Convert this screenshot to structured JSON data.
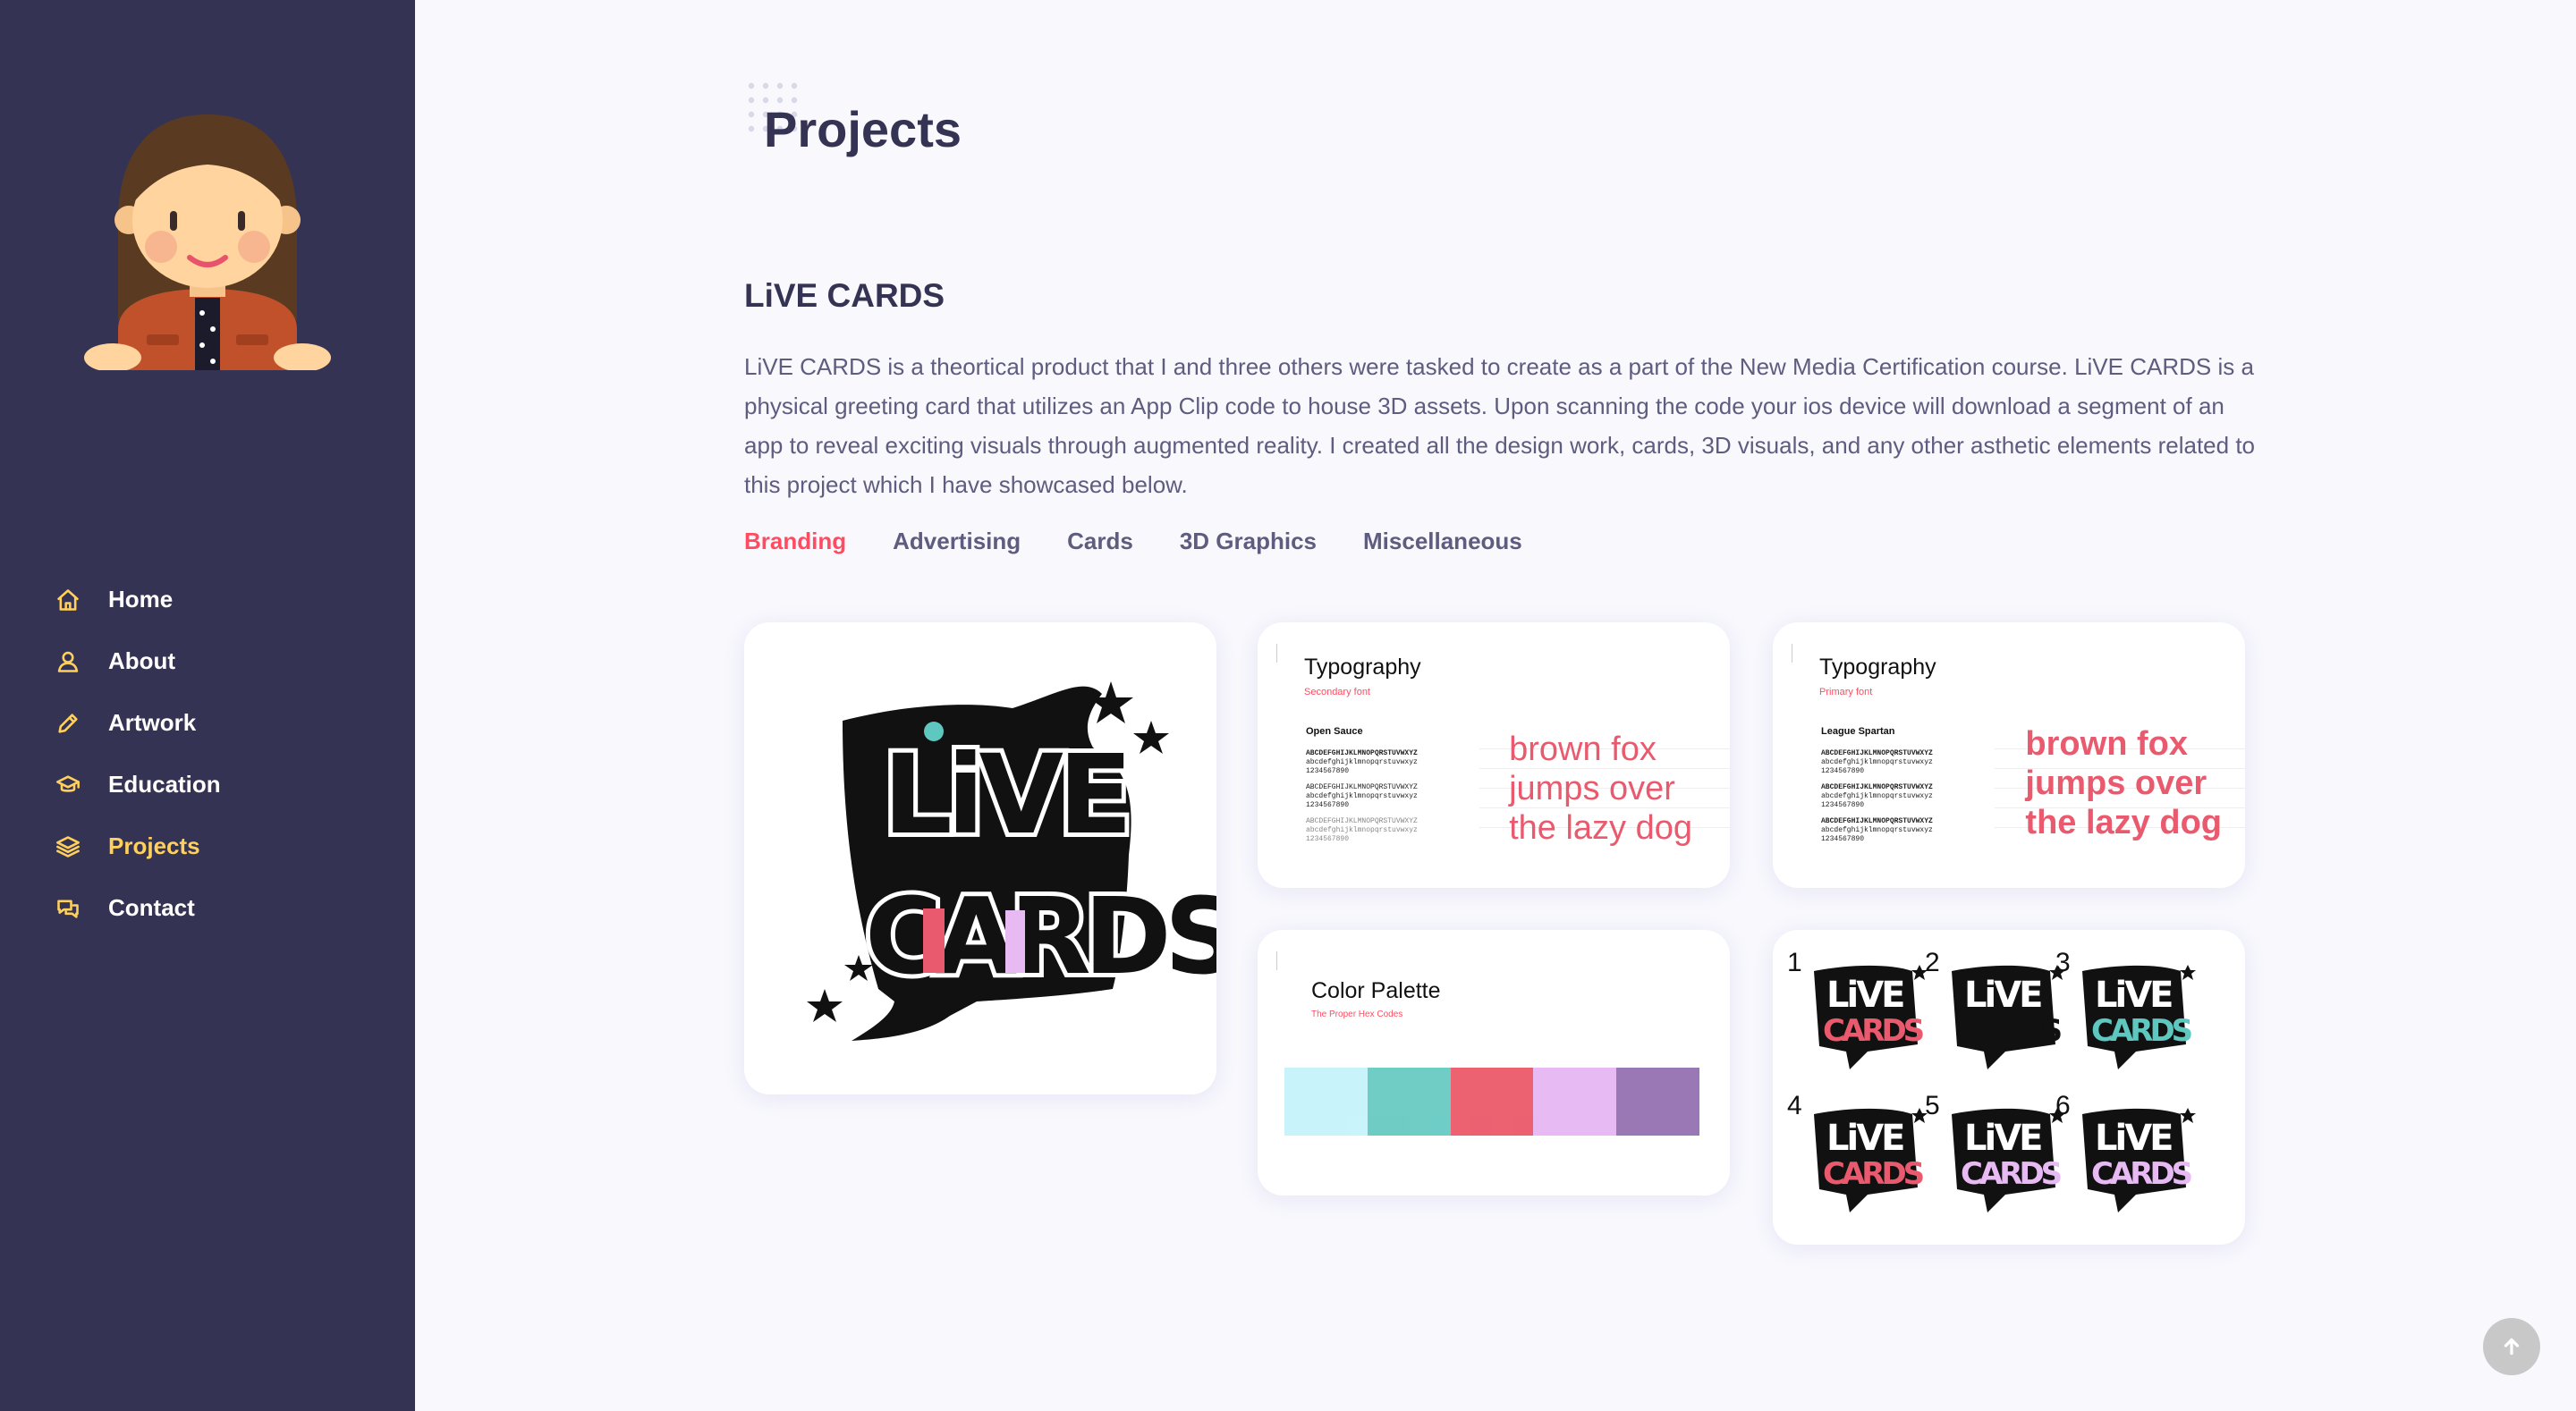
{
  "sidebar": {
    "nav": [
      {
        "label": "Home",
        "icon": "home-icon"
      },
      {
        "label": "About",
        "icon": "user-icon"
      },
      {
        "label": "Artwork",
        "icon": "pencil-icon"
      },
      {
        "label": "Education",
        "icon": "graduation-cap-icon"
      },
      {
        "label": "Projects",
        "icon": "layers-icon",
        "active": true
      },
      {
        "label": "Contact",
        "icon": "chat-bubbles-icon"
      }
    ]
  },
  "main": {
    "page_title": "Projects",
    "project": {
      "title": "LiVE CARDS",
      "description": "LiVE CARDS is a theortical product that I and three others were tasked to create as a part of the New Media Certification course. LiVE CARDS is a physical greeting card that utilizes an App Clip code to house 3D assets. Upon scanning the code your ios device will download a segment of an app to reveal exciting visuals through augmented reality. I created all the design work, cards, 3D visuals, and any other asthetic elements related to this project which I have showcased below."
    },
    "filters": [
      {
        "label": "Branding",
        "active": true
      },
      {
        "label": "Advertising"
      },
      {
        "label": "Cards"
      },
      {
        "label": "3D Graphics"
      },
      {
        "label": "Miscellaneous"
      }
    ],
    "gallery": {
      "typography_secondary": {
        "heading": "Typography",
        "subheading": "Secondary font",
        "font_name": "Open Sauce",
        "glyph_upper": "ABCDEFGHIJKLMNOPQRSTUVWXYZ",
        "glyph_lower": "abcdefghijklmnopqrstuvwxyz",
        "glyph_digits": "1234567890",
        "sample_line1": "brown fox",
        "sample_line2": "jumps over",
        "sample_line3": "the lazy dog"
      },
      "typography_primary": {
        "heading": "Typography",
        "subheading": "Primary font",
        "font_name": "League Spartan",
        "glyph_upper": "ABCDEFGHIJKLMNOPQRSTUVWXYZ",
        "glyph_lower": "abcdefghijklmnopqrstuvwxyz",
        "glyph_digits": "1234567890",
        "sample_line1": "brown fox",
        "sample_line2": "jumps over",
        "sample_line3": "the lazy dog"
      },
      "palette": {
        "heading": "Color Palette",
        "subheading": "The Proper Hex Codes",
        "colors": [
          "#c9f3fb",
          "#6fcdc5",
          "#ec6271",
          "#e8baf3",
          "#9a78b5"
        ]
      },
      "variations": [
        "1",
        "2",
        "3",
        "4",
        "5",
        "6"
      ]
    }
  },
  "colors": {
    "sidebar_bg": "#353353",
    "accent_yellow": "#ffd15c",
    "accent_red": "#ff4c60",
    "page_bg": "#f8f8fd"
  }
}
